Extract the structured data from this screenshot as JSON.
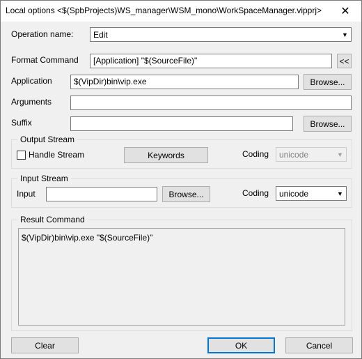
{
  "window": {
    "title": "Local options <$(SpbProjects)WS_manager\\WSM_mono\\WorkSpaceManager.vipprj>",
    "close_glyph": "✕"
  },
  "operation": {
    "label": "Operation name:",
    "value": "Edit",
    "arrow": "▼"
  },
  "format": {
    "label": "Format Command",
    "value": "[Application] \"$(SourceFile)\"",
    "button": "<<"
  },
  "application": {
    "label": "Application",
    "value": "$(VipDir)bin\\vip.exe",
    "button": "Browse..."
  },
  "arguments": {
    "label": "Arguments",
    "value": ""
  },
  "suffix": {
    "label": "Suffix",
    "value": "",
    "button": "Browse..."
  },
  "output_stream": {
    "title": "Output Stream",
    "handle_label": "Handle Stream",
    "keywords_button": "Keywords",
    "coding_label": "Coding",
    "coding_value": "unicode",
    "arrow": "▼"
  },
  "input_stream": {
    "title": "Input Stream",
    "input_label": "Input",
    "input_value": "",
    "browse_button": "Browse...",
    "coding_label": "Coding",
    "coding_value": "unicode",
    "arrow": "▼"
  },
  "result": {
    "title": "Result Command",
    "value": "$(VipDir)bin\\vip.exe \"$(SourceFile)\""
  },
  "footer": {
    "clear": "Clear",
    "ok": "OK",
    "cancel": "Cancel"
  }
}
